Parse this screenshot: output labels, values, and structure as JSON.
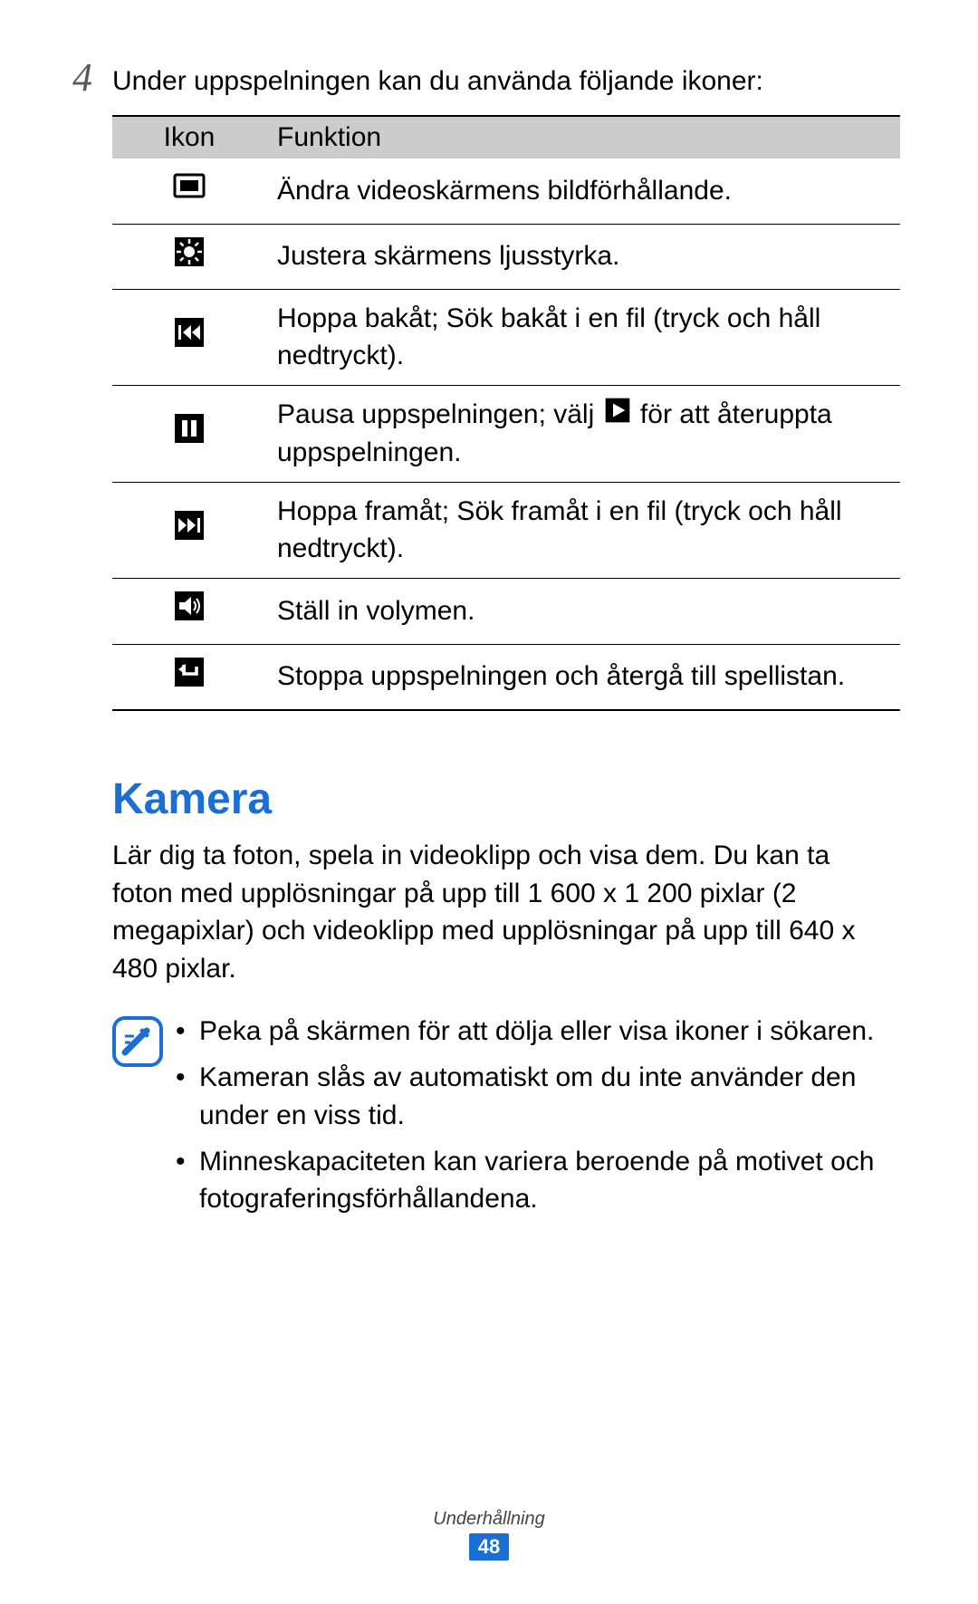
{
  "step": {
    "number": "4",
    "text": "Under uppspelningen kan du använda följande ikoner:"
  },
  "table": {
    "headers": {
      "icon": "Ikon",
      "function": "Funktion"
    },
    "rows": [
      {
        "icon": "aspect-ratio-icon",
        "text": "Ändra videoskärmens bildförhållande."
      },
      {
        "icon": "brightness-icon",
        "text": "Justera skärmens ljusstyrka."
      },
      {
        "icon": "skip-back-icon",
        "text": "Hoppa bakåt; Sök bakåt i en fil (tryck och håll nedtryckt)."
      },
      {
        "icon": "pause-icon",
        "text_pre": "Pausa uppspelningen; välj ",
        "text_post": " för att återuppta uppspelningen.",
        "inline_icon": "play-icon"
      },
      {
        "icon": "skip-forward-icon",
        "text": "Hoppa framåt; Sök framåt i en fil (tryck och håll nedtryckt)."
      },
      {
        "icon": "volume-icon",
        "text": "Ställ in volymen."
      },
      {
        "icon": "return-icon",
        "text": "Stoppa uppspelningen och återgå till spellistan."
      }
    ]
  },
  "section": {
    "heading": "Kamera",
    "body": "Lär dig ta foton, spela in videoklipp och visa dem. Du kan ta foton med upplösningar på upp till 1 600 x 1 200 pixlar (2 megapixlar) och videoklipp med upplösningar på upp till 640 x 480 pixlar.",
    "notes": [
      "Peka på skärmen för att dölja eller visa ikoner i sökaren.",
      "Kameran slås av automatiskt om du inte använder den under en viss tid.",
      "Minneskapaciteten kan variera beroende på motivet och fotograferingsförhållandena."
    ]
  },
  "footer": {
    "section_name": "Underhållning",
    "page_number": "48"
  }
}
